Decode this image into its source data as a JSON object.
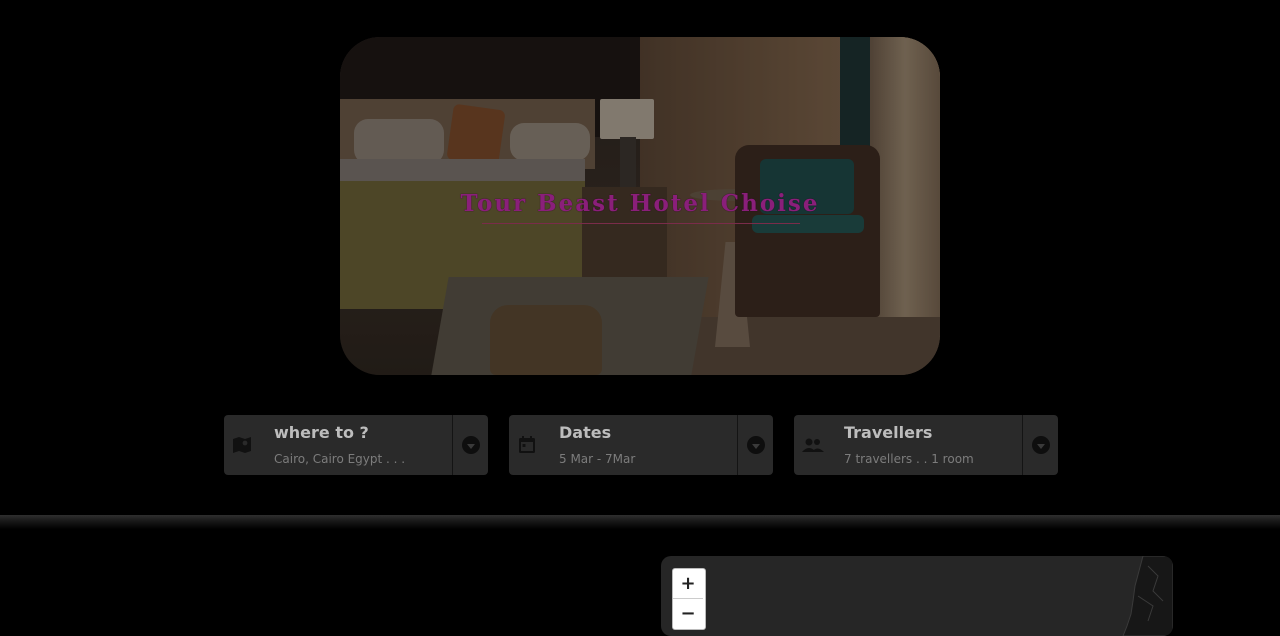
{
  "hero": {
    "title": "Tour Beast Hotel Choise"
  },
  "search": {
    "destination": {
      "icon": "map-icon",
      "title": "where to ?",
      "value": "Cairo, Cairo Egypt . . ."
    },
    "dates": {
      "icon": "calendar-icon",
      "title": "Dates",
      "value": "5 Mar - 7Mar"
    },
    "travellers": {
      "icon": "people-icon",
      "title": "Travellers",
      "value": "7 travellers . . 1 room"
    }
  },
  "map": {
    "zoom_in": "+",
    "zoom_out": "−"
  }
}
